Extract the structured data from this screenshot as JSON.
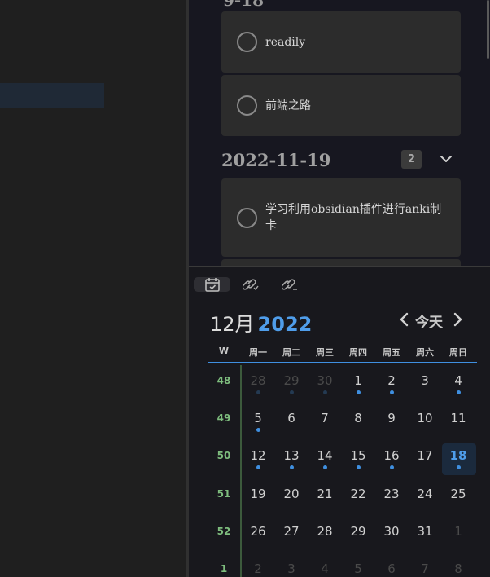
{
  "task_list": {
    "tasks_top": [
      {
        "text": "readily"
      },
      {
        "text": "前端之路"
      }
    ],
    "date_group": {
      "date": "2022-11-19",
      "count": "2"
    },
    "tasks_dated": [
      {
        "text": "学习利用obsidian插件进行anki制卡"
      }
    ]
  },
  "calendar": {
    "tab_icons": [
      "calendar-check-icon",
      "link-icon",
      "link-icon"
    ],
    "month_label": "12月",
    "year_label": "2022",
    "today_label": "今天",
    "week_header": "W",
    "weekdays": [
      "周一",
      "周二",
      "周三",
      "周四",
      "周五",
      "周六",
      "周日"
    ],
    "weeks": [
      {
        "num": "48",
        "days": [
          "28",
          "29",
          "30",
          "1",
          "2",
          "3",
          "4"
        ]
      },
      {
        "num": "49",
        "days": [
          "5",
          "6",
          "7",
          "8",
          "9",
          "10",
          "11"
        ]
      },
      {
        "num": "50",
        "days": [
          "12",
          "13",
          "14",
          "15",
          "16",
          "17",
          "18"
        ]
      },
      {
        "num": "51",
        "days": [
          "19",
          "20",
          "21",
          "22",
          "23",
          "24",
          "25"
        ]
      },
      {
        "num": "52",
        "days": [
          "26",
          "27",
          "28",
          "29",
          "30",
          "31",
          "1"
        ]
      },
      {
        "num": "1",
        "days": [
          "2",
          "3",
          "4",
          "5",
          "6",
          "7",
          "8"
        ]
      }
    ],
    "accent_color": "#3f8fe0",
    "week_number_color": "#7ebd7e"
  }
}
